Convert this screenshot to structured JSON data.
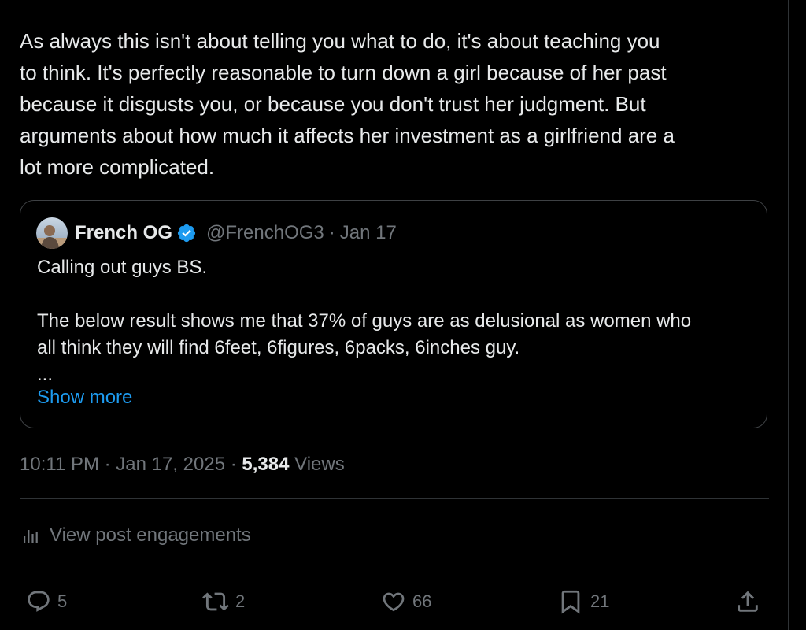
{
  "post": {
    "text_lines": [
      "As always this isn't about telling you what to do, it's about teaching you",
      "to think. It's perfectly reasonable to turn down a girl because of her past",
      "because it disgusts you, or because you don't trust her judgment. But",
      "arguments about how much it affects her investment as a girlfriend are a",
      "lot more complicated."
    ],
    "timestamp": "10:11 PM · Jan 17, 2025",
    "separator": " · ",
    "views_count": "5,384",
    "views_label": " Views"
  },
  "quote": {
    "author_name": "French OG",
    "author_handle": "@FrenchOG3",
    "dot": "·",
    "date": "Jan 17",
    "lines": [
      "Calling out guys BS.",
      "",
      "The below result shows me that 37% of guys are as delusional as women who",
      "all think they will find 6feet, 6figures, 6packs, 6inches guy.",
      "..."
    ],
    "show_more_label": "Show more"
  },
  "engagements": {
    "label": "View post engagements",
    "icon": "bar-chart-icon"
  },
  "actions": {
    "replies": {
      "icon": "reply-icon",
      "count": "5"
    },
    "reposts": {
      "icon": "repost-icon",
      "count": "2"
    },
    "likes": {
      "icon": "heart-icon",
      "count": "66"
    },
    "bookmarks": {
      "icon": "bookmark-icon",
      "count": "21"
    },
    "share": {
      "icon": "share-icon"
    }
  },
  "colors": {
    "background": "#000000",
    "text_primary": "#e7e9ea",
    "text_secondary": "#71767b",
    "accent": "#1d9bf0",
    "border": "#2f3336"
  }
}
